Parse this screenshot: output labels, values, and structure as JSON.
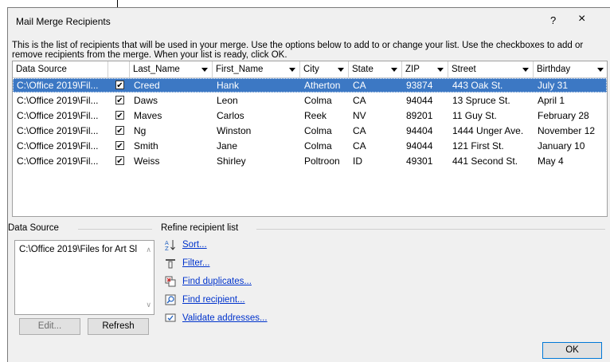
{
  "dialog": {
    "title": "Mail Merge Recipients",
    "help": "?",
    "close": "×",
    "intro": "This is the list of recipients that will be used in your merge.  Use the options below to add to or change your list.  Use the checkboxes to add or remove recipients from the merge.  When your list is ready, click OK."
  },
  "columns": [
    "Data Source",
    "Last_Name",
    "First_Name",
    "City",
    "State",
    "ZIP",
    "Street",
    "Birthday"
  ],
  "header_check": "✔",
  "rows": [
    {
      "source": "C:\\Office 2019\\Fil...",
      "check": "✔",
      "last": "Creed",
      "first": "Hank",
      "city": "Atherton",
      "state": "CA",
      "zip": "93874",
      "street": "443 Oak St.",
      "birthday": "July 31",
      "selected": true
    },
    {
      "source": "C:\\Office 2019\\Fil...",
      "check": "✔",
      "last": "Daws",
      "first": "Leon",
      "city": "Colma",
      "state": "CA",
      "zip": "94044",
      "street": "13 Spruce St.",
      "birthday": "April 1"
    },
    {
      "source": "C:\\Office 2019\\Fil...",
      "check": "✔",
      "last": "Maves",
      "first": "Carlos",
      "city": "Reek",
      "state": "NV",
      "zip": "89201",
      "street": "11 Guy St.",
      "birthday": "February 28"
    },
    {
      "source": "C:\\Office 2019\\Fil...",
      "check": "✔",
      "last": "Ng",
      "first": "Winston",
      "city": "Colma",
      "state": "CA",
      "zip": "94404",
      "street": "1444 Unger Ave.",
      "birthday": "November 12"
    },
    {
      "source": "C:\\Office 2019\\Fil...",
      "check": "✔",
      "last": "Smith",
      "first": "Jane",
      "city": "Colma",
      "state": "CA",
      "zip": "94044",
      "street": "121 First St.",
      "birthday": "January 10"
    },
    {
      "source": "C:\\Office 2019\\Fil...",
      "check": "✔",
      "last": "Weiss",
      "first": "Shirley",
      "city": "Poltroon",
      "state": "ID",
      "zip": "49301",
      "street": "441 Second St.",
      "birthday": "May 4"
    }
  ],
  "data_source": {
    "label": "Data Source",
    "item": "C:\\Office 2019\\Files for Art Sl",
    "edit": "Edit...",
    "refresh": "Refresh"
  },
  "refine": {
    "label": "Refine recipient list",
    "sort": "Sort...",
    "filter": "Filter...",
    "duplicates": "Find duplicates...",
    "recipient": "Find recipient...",
    "validate": "Validate addresses..."
  },
  "ok": "OK",
  "colors": {
    "selection": "#3c78c4",
    "link": "#0033cc",
    "dialog_bg": "#f0f0f0"
  }
}
